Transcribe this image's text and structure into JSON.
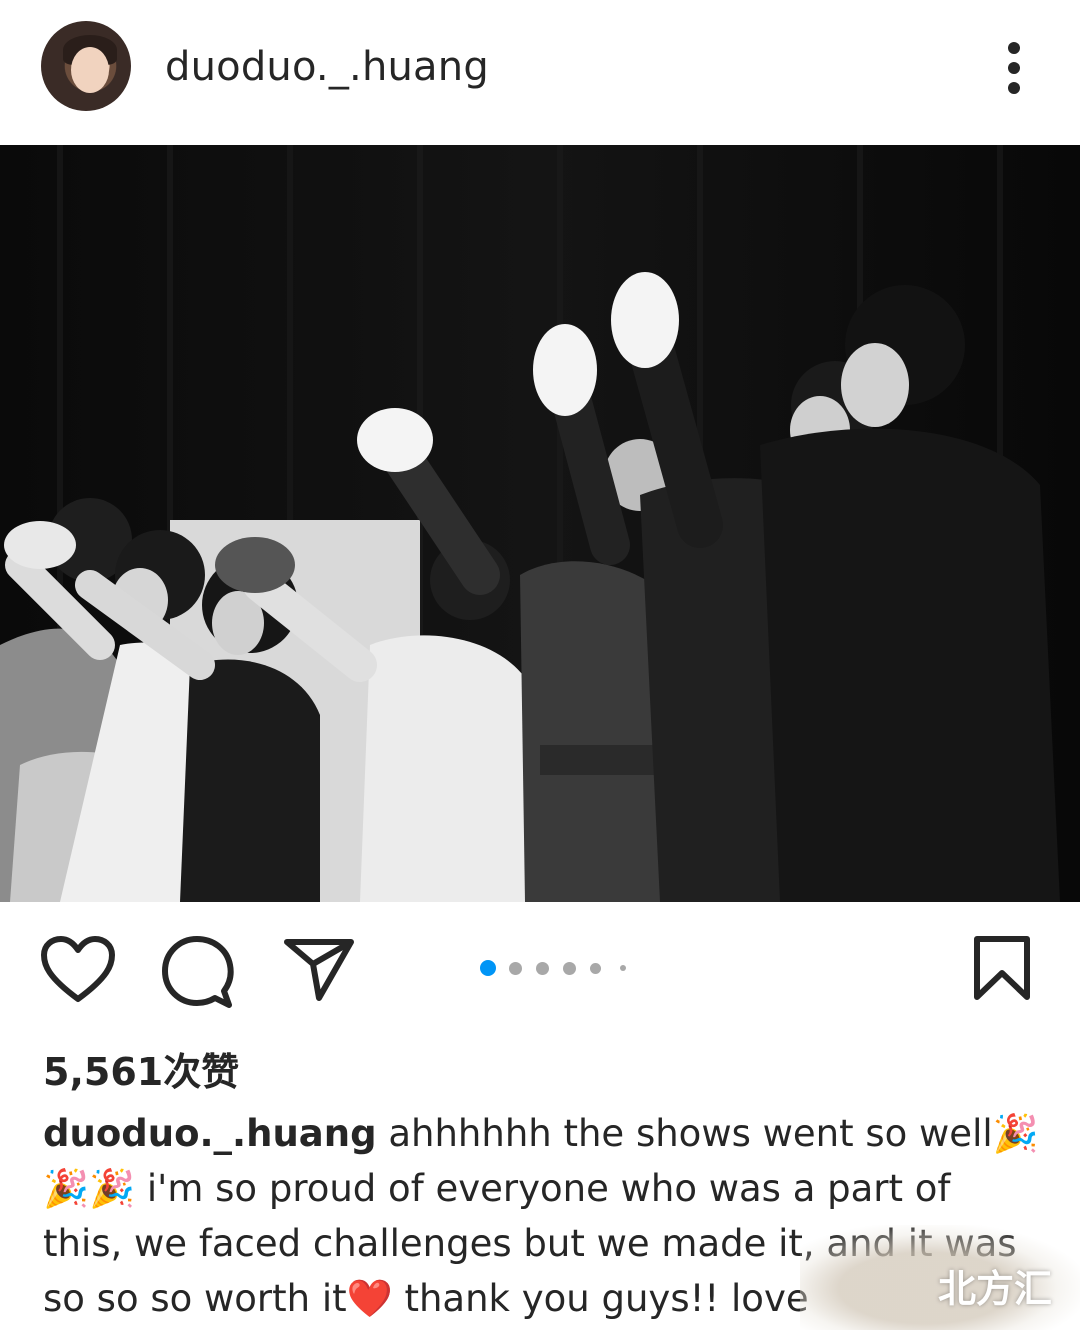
{
  "post": {
    "username": "duoduo._.huang",
    "likes_text": "5,561次赞",
    "caption_user": "duoduo._.huang",
    "caption_line1": " ahhhhhh the shows went so well🎉",
    "caption_line2": "🎉🎉 i'm so proud of everyone who was a part of",
    "caption_line3": "this, we faced challenges but we made it, and it was",
    "caption_line4": "so so so worth it❤️ thank you guys!! love",
    "carousel": {
      "total": 6,
      "active_index": 0
    }
  },
  "icons": {
    "more": "more-vertical-icon",
    "like": "heart-icon",
    "comment": "comment-icon",
    "share": "send-icon",
    "save": "bookmark-icon"
  },
  "watermark": "北方汇",
  "colors": {
    "accent": "#0095f6",
    "text": "#262626",
    "inactive_dot": "#a8a8a8"
  }
}
